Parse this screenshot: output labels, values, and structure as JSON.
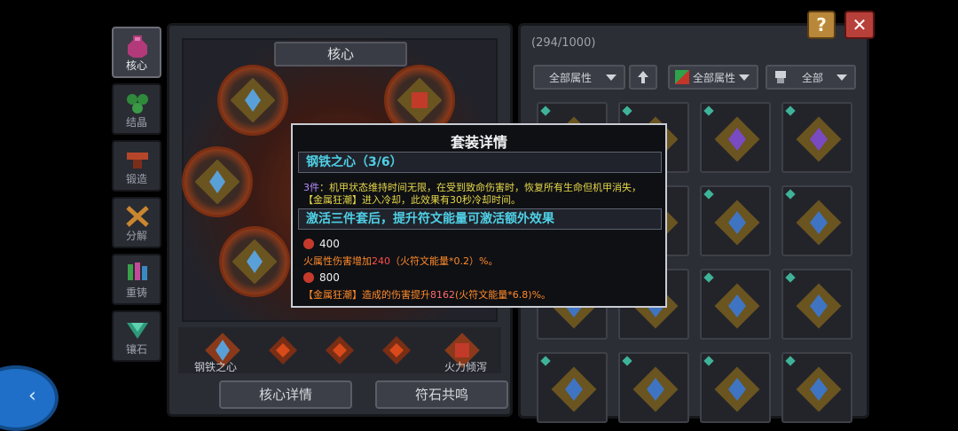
{
  "side_tabs": [
    {
      "label": "核心",
      "active": true,
      "icon": "core-vase-icon"
    },
    {
      "label": "结晶",
      "active": false,
      "icon": "crystal-cluster-icon"
    },
    {
      "label": "锻造",
      "active": false,
      "icon": "anvil-icon"
    },
    {
      "label": "分解",
      "active": false,
      "icon": "hammer-cross-icon"
    },
    {
      "label": "重铸",
      "active": false,
      "icon": "recast-gems-icon"
    },
    {
      "label": "镶石",
      "active": false,
      "icon": "inlay-gem-icon"
    }
  ],
  "core_panel": {
    "title": "核心",
    "set_left_label": "钢铁之心",
    "set_right_label": "火力倾泻",
    "detail_button": "核心详情",
    "resonance_button": "符石共鸣"
  },
  "inventory": {
    "capacity": "(294/1000)",
    "filter_attr": "全部属性",
    "filter_color": "全部属性",
    "filter_type": "全部",
    "sort_icon": "up-arrow-icon"
  },
  "buttons": {
    "help": "?",
    "close": "✕"
  },
  "modal": {
    "title": "套装详情",
    "set_name": "钢铁之心（3/6）",
    "effect_prefix": "3件",
    "effect_line1": "：机甲状态维持时间无限，在受到致命伤害时，恢复所有生命但机甲消失，",
    "effect_line2": "【金属狂潮】进入冷却，此效果有30秒冷却时间。",
    "bonus_header": "激活三件套后，提升符文能量可激活额外效果",
    "tier1_value": "400",
    "tier1_text_a": "火属性伤害增加",
    "tier1_num": "240",
    "tier1_text_b": "（火符文能量*0.2）%。",
    "tier2_value": "800",
    "tier2_text_a": "【金属狂潮】造成的伤害提升",
    "tier2_num": "8162",
    "tier2_text_b": "(火符文能量*6.8)%。"
  },
  "colors": {
    "accent_cyan": "#4fd0e6",
    "fire_orange": "#ff8a2a",
    "highlight_red": "#ff4d4d"
  }
}
